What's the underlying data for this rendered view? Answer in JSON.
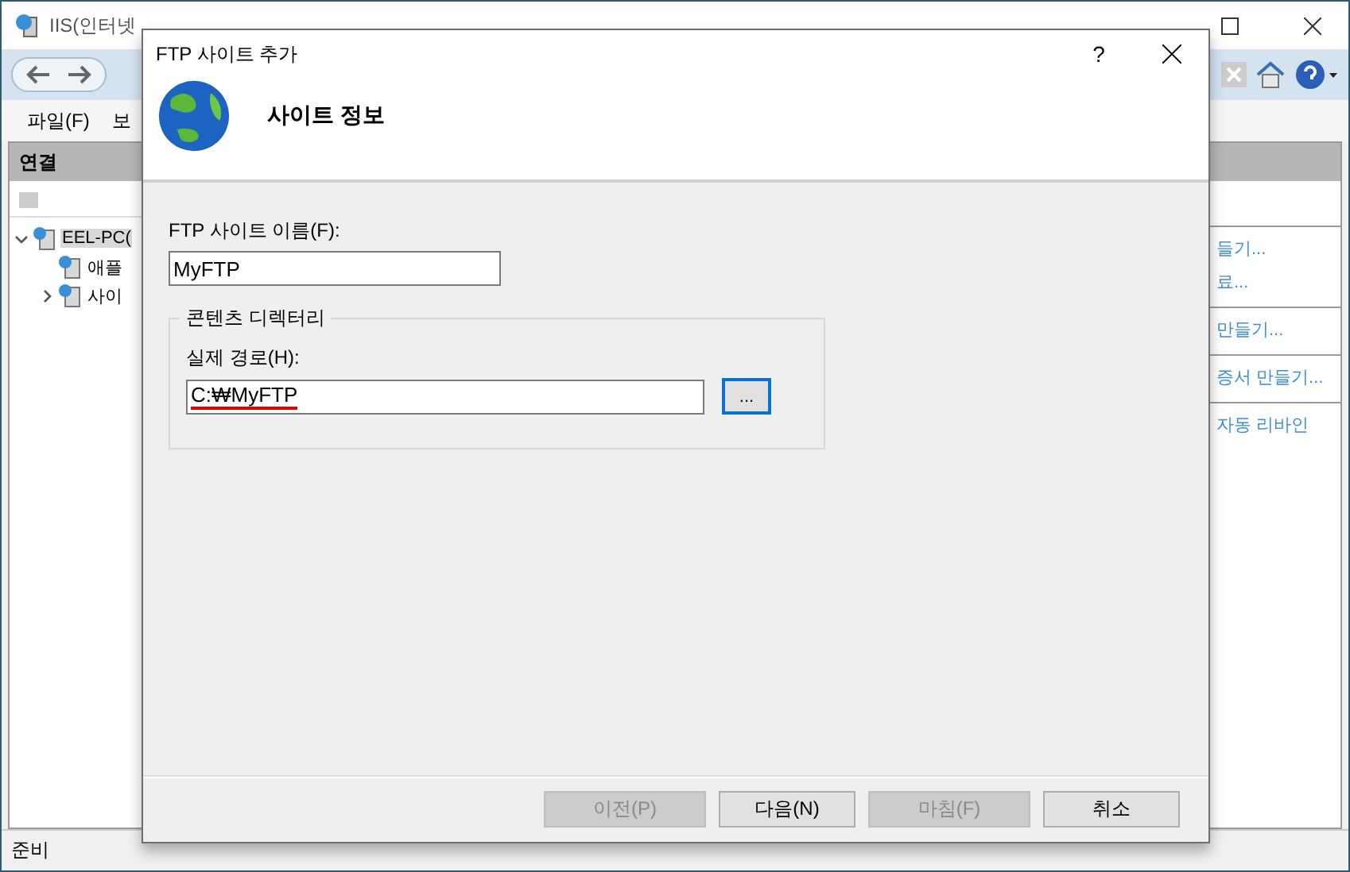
{
  "main_window": {
    "title": "IIS(인터넷",
    "menu": [
      "파일(F)",
      "보"
    ],
    "connections": {
      "header": "연결",
      "tree": [
        {
          "label": "EEL-PC(",
          "selected": true,
          "expanded": true,
          "children": [
            {
              "label": "애플",
              "selected": false
            },
            {
              "label": "사이",
              "selected": false,
              "expanded": false
            }
          ]
        }
      ]
    },
    "actions": [
      [
        "들기...",
        "료..."
      ],
      [
        "만들기..."
      ],
      [
        "증서 만들기..."
      ],
      [
        "자동 리바인"
      ]
    ],
    "status": "준비"
  },
  "dialog": {
    "title": "FTP 사이트 추가",
    "help": "?",
    "header": "사이트 정보",
    "site_name": {
      "label": "FTP 사이트 이름(F):",
      "value": "MyFTP"
    },
    "content_dir": {
      "legend": "콘텐츠 디렉터리",
      "path_label": "실제 경로(H):",
      "path_value": "C:₩MyFTP",
      "browse": "..."
    },
    "buttons": [
      {
        "label": "이전(P)",
        "disabled": true
      },
      {
        "label": "다음(N)",
        "disabled": false
      },
      {
        "label": "마침(F)",
        "disabled": true
      },
      {
        "label": "취소",
        "disabled": false
      }
    ]
  }
}
